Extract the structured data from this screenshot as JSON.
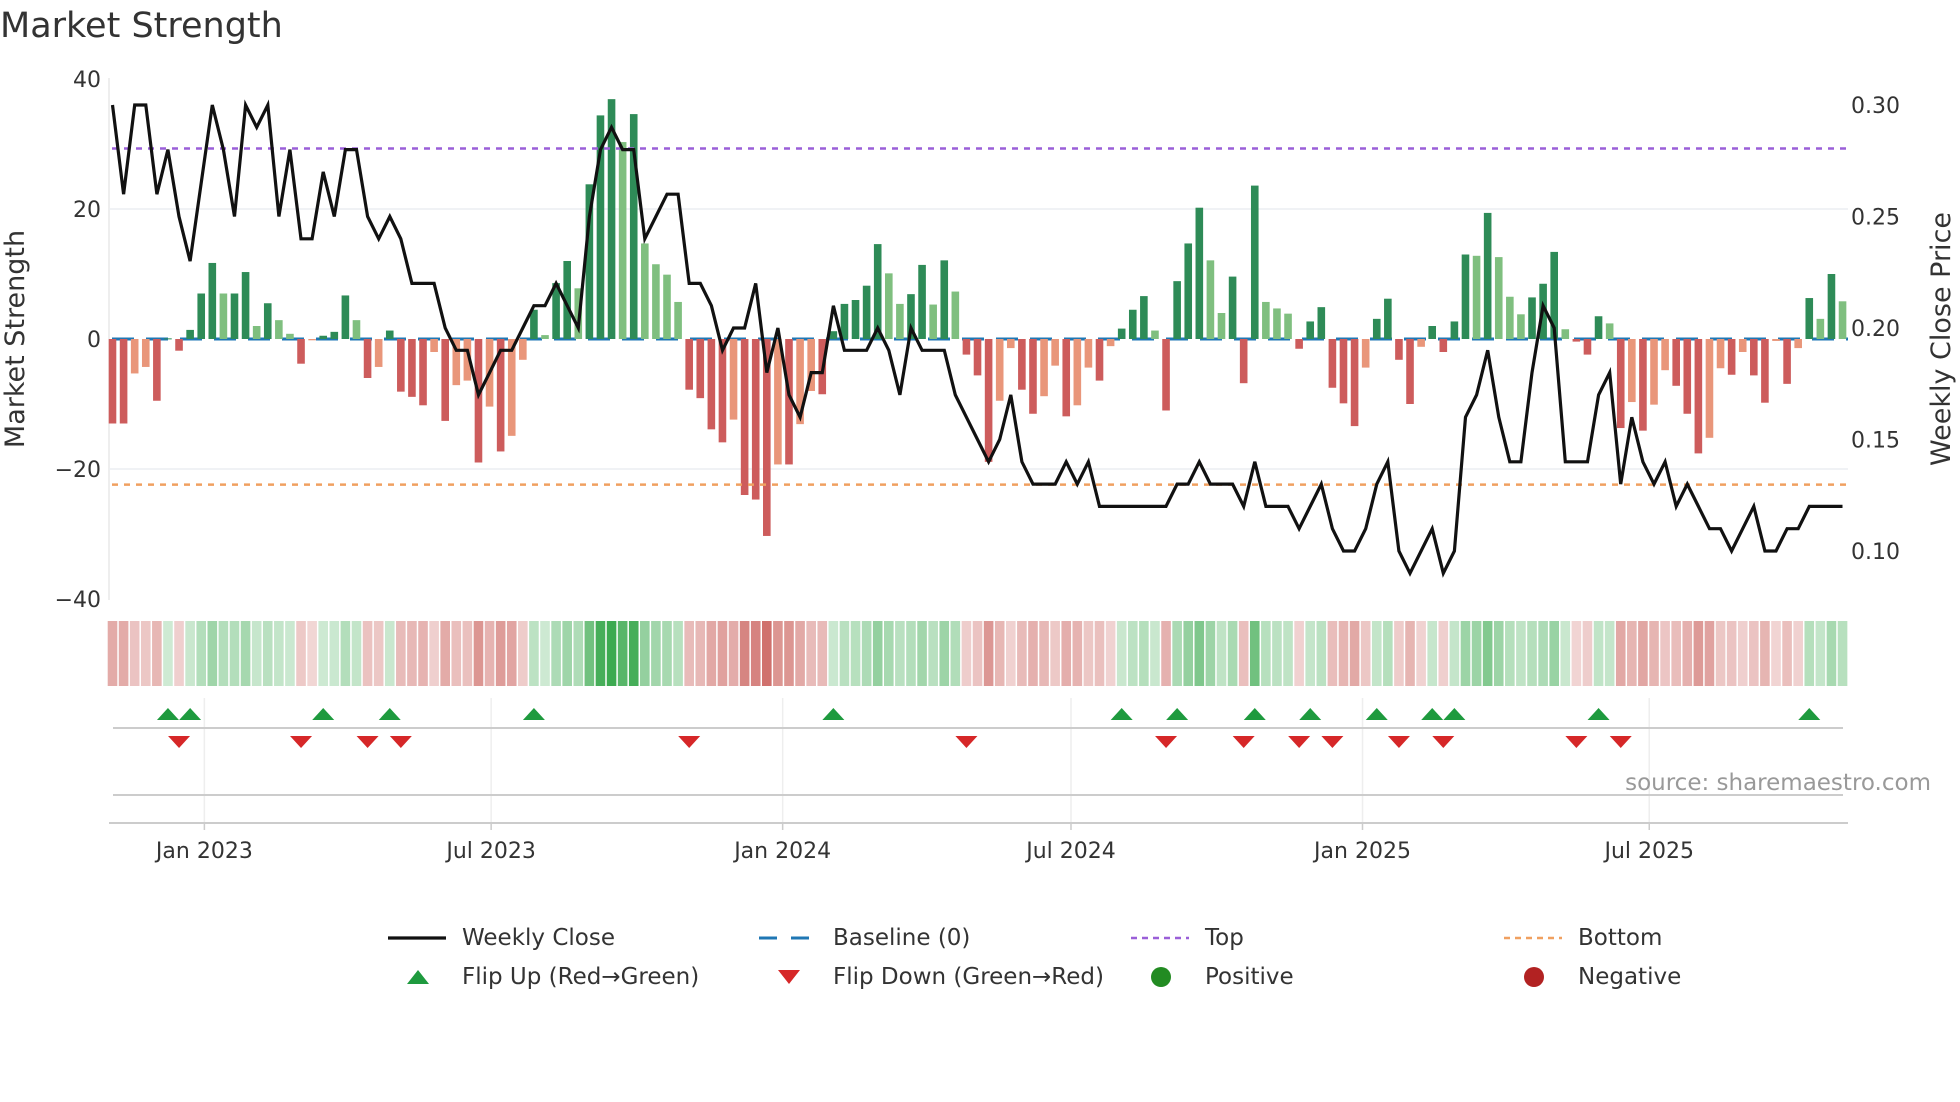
{
  "title": "Market Strength",
  "source": "source: sharemaestro.com",
  "chart_data": {
    "type": "bar",
    "title": "Market Strength",
    "ylabel": "Market Strength",
    "y2label": "Weekly Close Price",
    "ylim": [
      -40,
      40
    ],
    "y2lim": [
      0.08,
      0.31
    ],
    "yticks": [
      "40",
      "20",
      "0",
      "−20",
      "−40"
    ],
    "ytick_values": [
      40,
      20,
      0,
      -20,
      -40
    ],
    "y2ticks": [
      "0.30",
      "0.25",
      "0.20",
      "0.15",
      "0.10"
    ],
    "y2tick_values": [
      0.3,
      0.25,
      0.2,
      0.15,
      0.1
    ],
    "start_date": "2022-11-04",
    "frequency": "weekly",
    "xticks": [
      {
        "label": "Jan 2023",
        "date": "2023-01-01"
      },
      {
        "label": "Jul 2023",
        "date": "2023-07-01"
      },
      {
        "label": "Jan 2024",
        "date": "2024-01-01"
      },
      {
        "label": "Jul 2024",
        "date": "2024-07-01"
      },
      {
        "label": "Jan 2025",
        "date": "2025-01-01"
      },
      {
        "label": "Jul 2025",
        "date": "2025-07-01"
      }
    ],
    "top_level": 29.3,
    "bottom_level": -22.4,
    "baseline": 0,
    "strength": [
      -13,
      -13,
      -5.3,
      -4.3,
      -9.5,
      0.1,
      -1.8,
      1.4,
      7,
      11.7,
      7,
      7,
      10.3,
      2,
      5.5,
      2.9,
      0.8,
      -3.8,
      -0.2,
      0.5,
      1.1,
      6.7,
      2.9,
      -6,
      -4.3,
      1.3,
      -8.1,
      -8.9,
      -10.2,
      -2,
      -12.6,
      -7.1,
      -6.4,
      -19,
      -10.4,
      -17.3,
      -14.9,
      -3.2,
      4.5,
      0.6,
      8.6,
      12,
      7.8,
      23.8,
      34.4,
      36.9,
      30.3,
      34.6,
      14.7,
      11.5,
      9.9,
      5.7,
      -7.8,
      -9.1,
      -13.9,
      -15.9,
      -12.4,
      -24,
      -24.7,
      -30.3,
      -19.3,
      -19.3,
      -13.1,
      -8,
      -8.5,
      1.2,
      5.4,
      6,
      8.2,
      14.6,
      10.1,
      5.4,
      6.9,
      11.4,
      5.3,
      12.1,
      7.3,
      -2.4,
      -5.6,
      -18.9,
      -9.5,
      -1.4,
      -7.8,
      -11.5,
      -8.8,
      -4.1,
      -11.9,
      -10.2,
      -4.4,
      -6.4,
      -1.1,
      1.6,
      4.5,
      6.6,
      1.3,
      -11,
      8.9,
      14.7,
      20.2,
      12.1,
      4,
      9.6,
      -6.8,
      23.6,
      5.7,
      4.7,
      3.9,
      -1.5,
      2.7,
      4.9,
      -7.5,
      -9.9,
      -13.4,
      -4.4,
      3.1,
      6.2,
      -3.2,
      -10,
      -1.2,
      2,
      -2,
      2.7,
      13,
      12.8,
      19.4,
      12.6,
      6.5,
      3.8,
      6.4,
      8.5,
      13.4,
      1.5,
      -0.4,
      -2.4,
      3.5,
      2.4,
      -13.7,
      -9.7,
      -14.1,
      -10.1,
      -4.8,
      -7.2,
      -11.5,
      -17.6,
      -15.2,
      -4.5,
      -5.5,
      -2,
      -5.6,
      -9.8,
      -0.3,
      -6.9,
      -1.4,
      6.3,
      3.1,
      10,
      5.8
    ],
    "weekly_close": [
      0.3,
      0.26,
      0.3,
      0.3,
      0.26,
      0.28,
      0.25,
      0.23,
      0.265,
      0.3,
      0.28,
      0.25,
      0.3,
      0.29,
      0.3,
      0.25,
      0.28,
      0.24,
      0.24,
      0.27,
      0.25,
      0.28,
      0.28,
      0.25,
      0.24,
      0.25,
      0.24,
      0.22,
      0.22,
      0.22,
      0.2,
      0.19,
      0.19,
      0.17,
      0.18,
      0.19,
      0.19,
      0.2,
      0.21,
      0.21,
      0.22,
      0.21,
      0.2,
      0.25,
      0.28,
      0.29,
      0.28,
      0.28,
      0.24,
      0.25,
      0.26,
      0.26,
      0.22,
      0.22,
      0.21,
      0.19,
      0.2,
      0.2,
      0.22,
      0.18,
      0.2,
      0.17,
      0.16,
      0.18,
      0.18,
      0.21,
      0.19,
      0.19,
      0.19,
      0.2,
      0.19,
      0.17,
      0.2,
      0.19,
      0.19,
      0.19,
      0.17,
      0.16,
      0.15,
      0.14,
      0.15,
      0.17,
      0.14,
      0.13,
      0.13,
      0.13,
      0.14,
      0.13,
      0.14,
      0.12,
      0.12,
      0.12,
      0.12,
      0.12,
      0.12,
      0.12,
      0.13,
      0.13,
      0.14,
      0.13,
      0.13,
      0.13,
      0.12,
      0.14,
      0.12,
      0.12,
      0.12,
      0.11,
      0.12,
      0.13,
      0.11,
      0.1,
      0.1,
      0.11,
      0.13,
      0.14,
      0.1,
      0.09,
      0.1,
      0.11,
      0.09,
      0.1,
      0.16,
      0.17,
      0.19,
      0.16,
      0.14,
      0.14,
      0.18,
      0.21,
      0.2,
      0.14,
      0.14,
      0.14,
      0.17,
      0.18,
      0.13,
      0.16,
      0.14,
      0.13,
      0.14,
      0.12,
      0.13,
      0.12,
      0.11,
      0.11,
      0.1,
      0.11,
      0.12,
      0.1,
      0.1,
      0.11,
      0.11,
      0.12,
      0.12,
      0.12,
      0.12
    ],
    "colors": {
      "up_strong": "#2e8b57",
      "up_weak": "#7fbf7f",
      "down_strong": "#cd5c5c",
      "down_weak": "#e9967a",
      "close": "#111111",
      "baseline": "#1f77b4",
      "top": "#9a5fd8",
      "bottom": "#f0a060",
      "flip_up": "#1e9a3e",
      "flip_down": "#d62728",
      "positive": "#228b22",
      "negative": "#b22222"
    },
    "legend": [
      {
        "label": "Weekly Close",
        "kind": "line"
      },
      {
        "label": "Baseline (0)",
        "kind": "baseline"
      },
      {
        "label": "Top",
        "kind": "top"
      },
      {
        "label": "Bottom",
        "kind": "bottom"
      },
      {
        "label": "Flip Up (Red→Green)",
        "kind": "flip_up"
      },
      {
        "label": "Flip Down (Green→Red)",
        "kind": "flip_down"
      },
      {
        "label": "Positive",
        "kind": "positive"
      },
      {
        "label": "Negative",
        "kind": "negative"
      }
    ],
    "legend_position": "bottom-center"
  }
}
